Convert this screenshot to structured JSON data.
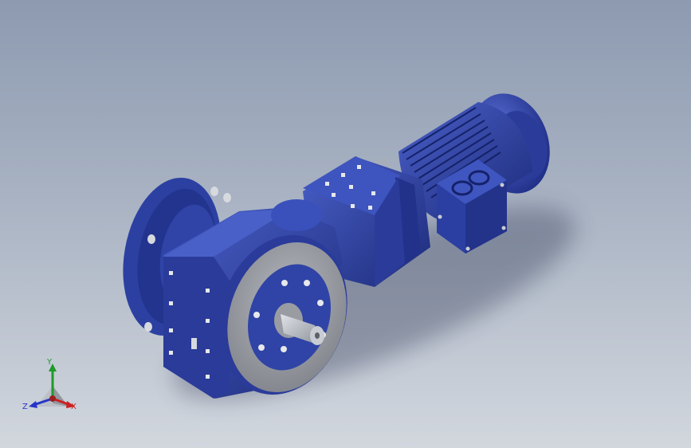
{
  "viewport": {
    "background_top": "#8d9ab0",
    "background_bottom": "#d2d7de"
  },
  "model": {
    "body_color": "#2f44a6",
    "body_dark": "#1c2a78",
    "body_light": "#4a60c9",
    "flange_face_color": "#9a9ca3",
    "shaft_color": "#b9bdc4"
  },
  "triad": {
    "x_label": "X",
    "y_label": "Y",
    "z_label": "Z",
    "x_color": "#cc1f1f",
    "y_color": "#1e9a2a",
    "z_color": "#2535c8"
  }
}
